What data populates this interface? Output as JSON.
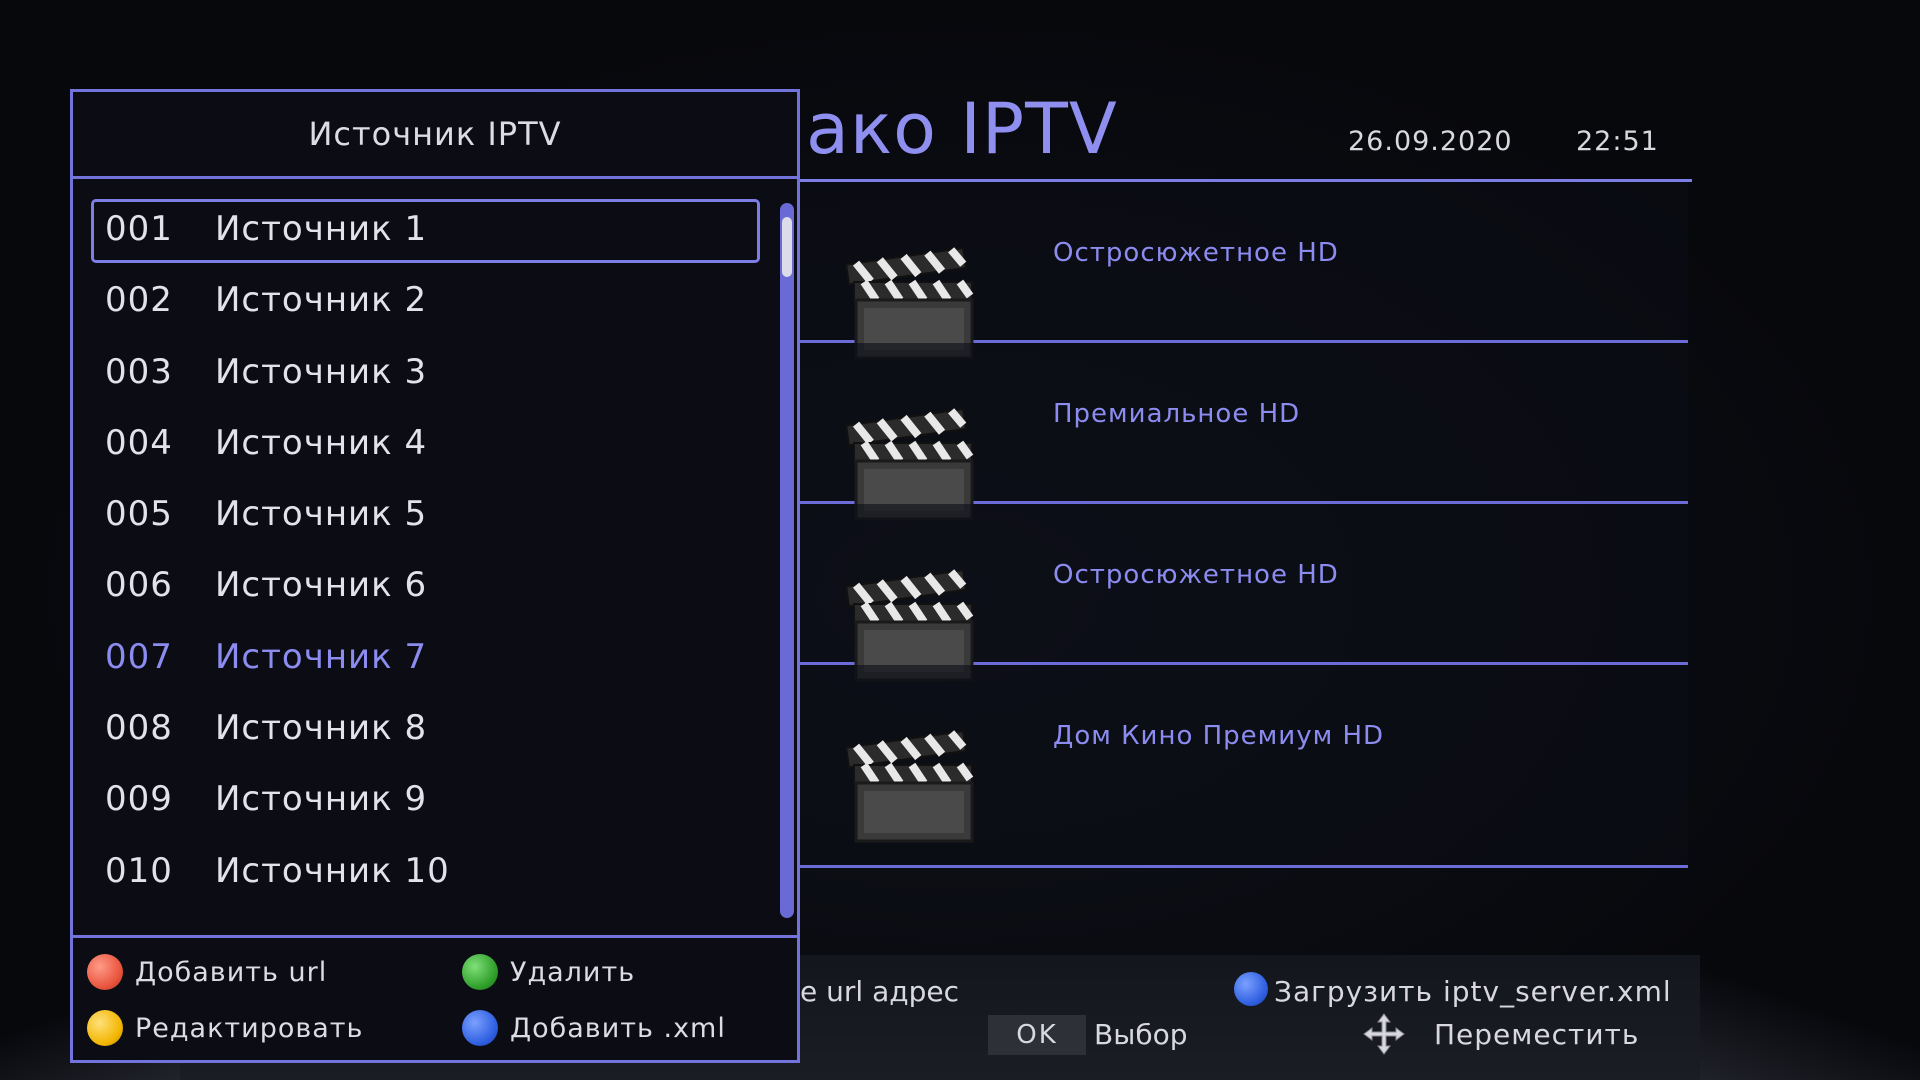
{
  "background": {
    "title": "Облако IPTV",
    "date": "26.09.2020",
    "time": "22:51",
    "channels": [
      {
        "name": "Остросюжетное HD"
      },
      {
        "name": "Премиальное HD"
      },
      {
        "name": "Остросюжетное HD"
      },
      {
        "name": "Дом Кино Премиум HD"
      }
    ],
    "hints": {
      "url_hint": "е url адрес",
      "ok_key": "OK",
      "ok_label": "Выбор",
      "load_label": "Загрузить iptv_server.xml",
      "move_label": "Переместить"
    }
  },
  "dialog": {
    "title": "Источник IPTV",
    "items": [
      {
        "num": "001",
        "name": "Источник 1"
      },
      {
        "num": "002",
        "name": "Источник 2"
      },
      {
        "num": "003",
        "name": "Источник 3"
      },
      {
        "num": "004",
        "name": "Источник 4"
      },
      {
        "num": "005",
        "name": "Источник 5"
      },
      {
        "num": "006",
        "name": "Источник 6"
      },
      {
        "num": "007",
        "name": "Источник 7"
      },
      {
        "num": "008",
        "name": "Источник 8"
      },
      {
        "num": "009",
        "name": "Источник 9"
      },
      {
        "num": "010",
        "name": "Источник 10"
      }
    ],
    "selected_index": 0,
    "marked_index": 6,
    "footer": {
      "red": "Добавить url",
      "green": "Удалить",
      "yellow": "Редактировать",
      "blue": "Добавить .xml"
    }
  },
  "colors": {
    "accent": "#7373dc",
    "highlight_text": "#8c8cf0",
    "red": "#e8533c",
    "green": "#2f9e2a",
    "yellow": "#f2b600",
    "blue": "#2f5fe0"
  }
}
